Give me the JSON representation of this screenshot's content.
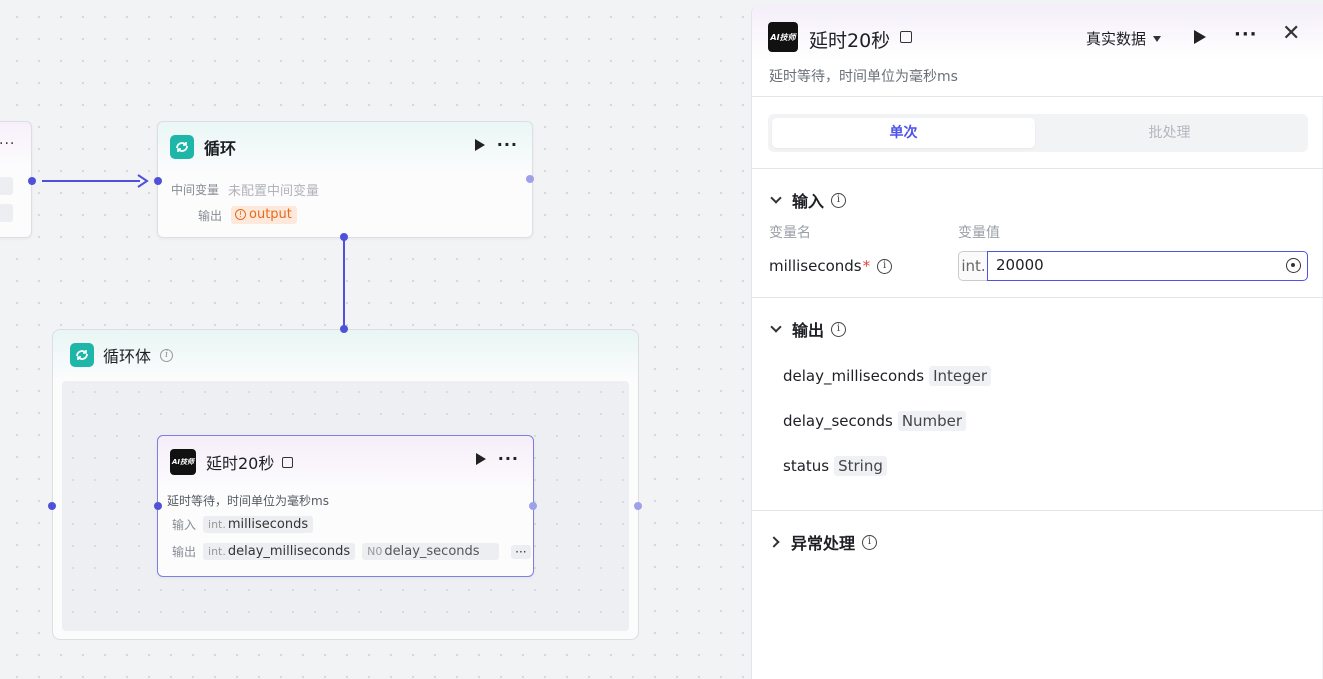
{
  "canvas": {
    "loop_node": {
      "title": "循环",
      "mid_var_label": "中间变量",
      "mid_var_value": "未配置中间变量",
      "output_label": "输出",
      "output_tag": "output"
    },
    "loop_body": {
      "title": "循环体"
    },
    "delay_node": {
      "title": "延时20秒",
      "logo_text": "AI技师",
      "description": "延时等待，时间单位为毫秒ms",
      "input_label": "输入",
      "input_type": "int.",
      "input_name": "milliseconds",
      "output_label": "输出",
      "outputs": [
        {
          "type": "int.",
          "name": "delay_milliseconds"
        },
        {
          "type": "N0",
          "name": "delay_seconds"
        }
      ],
      "more": "···"
    }
  },
  "panel": {
    "logo_text": "AI技师",
    "title": "延时20秒",
    "data_mode": "真实数据",
    "description": "延时等待，时间单位为毫秒ms",
    "tabs": [
      {
        "label": "单次",
        "active": true
      },
      {
        "label": "批处理",
        "active": false
      }
    ],
    "input_section": {
      "title": "输入",
      "col_name": "变量名",
      "col_value": "变量值",
      "param_name": "milliseconds",
      "required_mark": "*",
      "param_type": "int.",
      "param_value": "20000"
    },
    "output_section": {
      "title": "输出",
      "items": [
        {
          "name": "delay_milliseconds",
          "type": "Integer"
        },
        {
          "name": "delay_seconds",
          "type": "Number"
        },
        {
          "name": "status",
          "type": "String"
        }
      ]
    },
    "error_section": {
      "title": "异常处理"
    }
  },
  "colors": {
    "accent": "#4d53e8",
    "edge": "#4f52d8",
    "loop_icon": "#1eb6a8",
    "warning": "#e86a1a"
  }
}
